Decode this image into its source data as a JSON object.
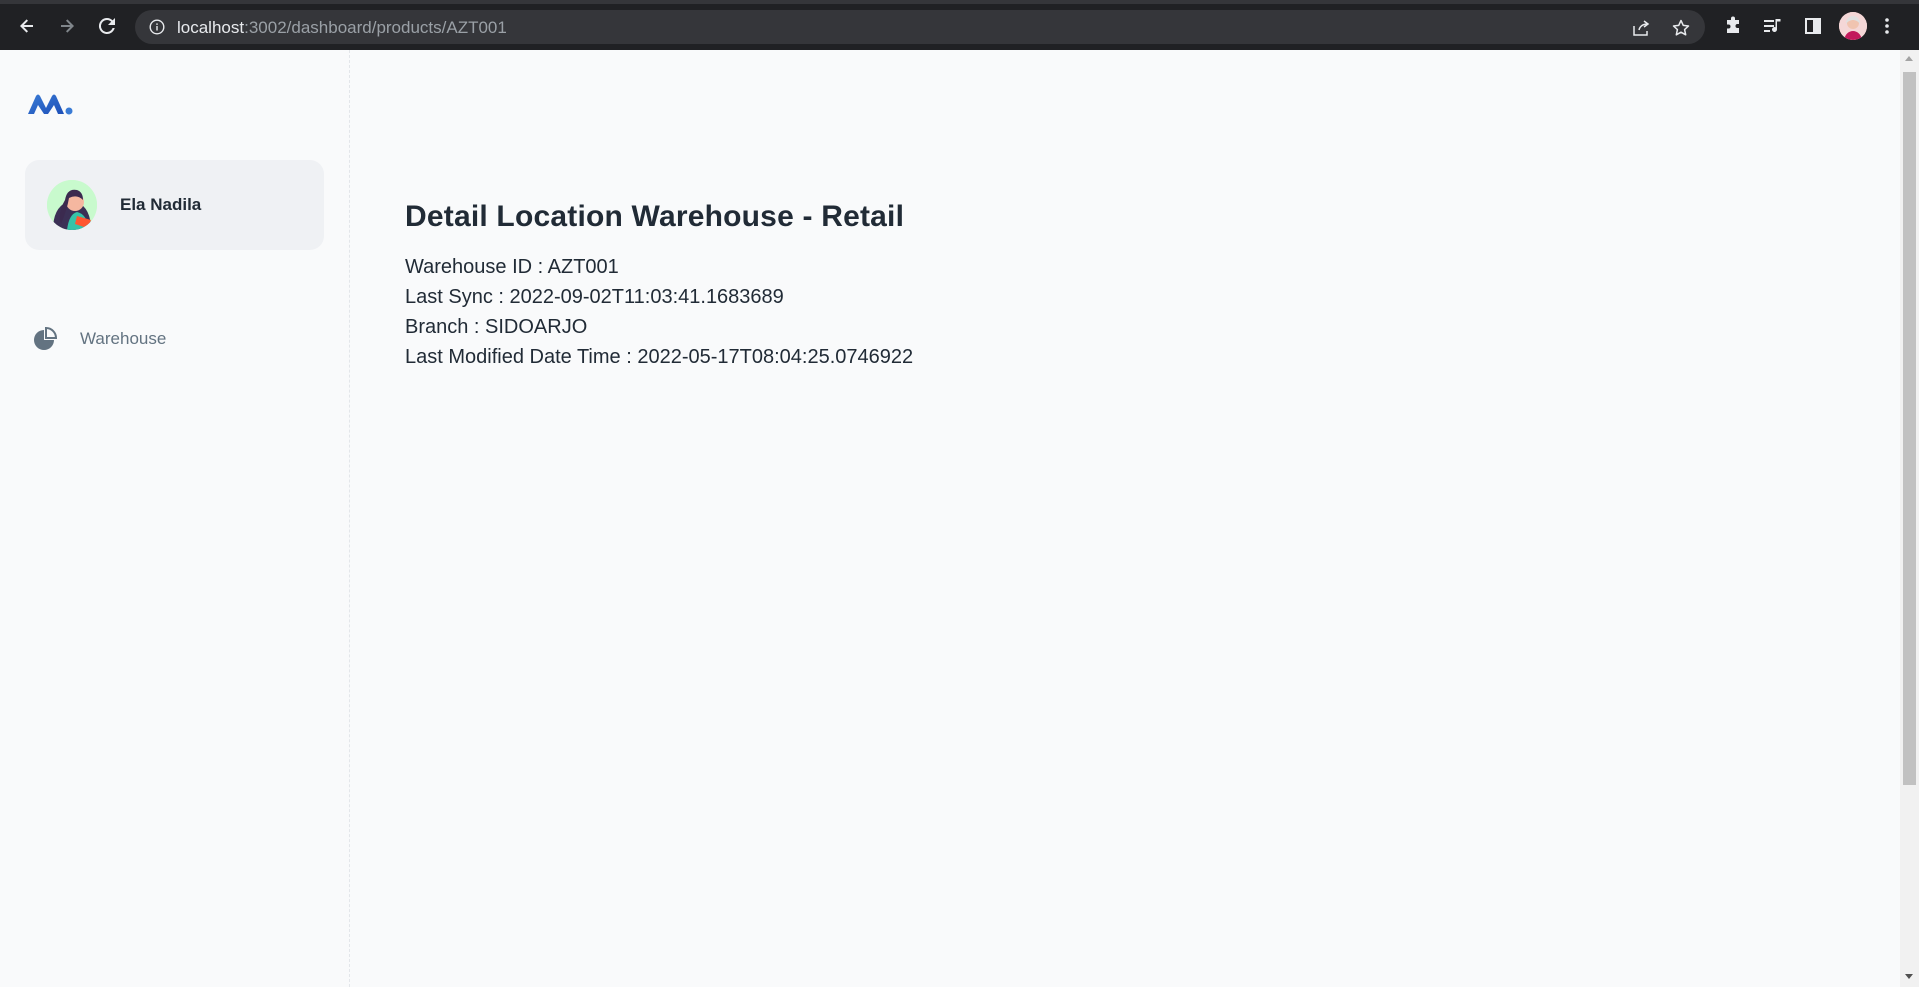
{
  "browser": {
    "url_host": "localhost",
    "url_rest": ":3002/dashboard/products/AZT001"
  },
  "sidebar": {
    "account_name": "Ela Nadila",
    "nav_items": [
      {
        "label": "Warehouse",
        "icon": "pie-chart-icon"
      }
    ]
  },
  "main": {
    "title": "Detail Location Warehouse - Retail",
    "details": [
      "Warehouse ID : AZT001",
      "Last Sync : 2022-09-02T11:03:41.1683689",
      "Branch : SIDOARJO",
      "Last Modified Date Time : 2022-05-17T08:04:25.0746922"
    ]
  },
  "colors": {
    "chrome_bg": "#202124",
    "omnibox_bg": "#35363a",
    "page_bg": "#f9fafb",
    "text_primary": "#212b36",
    "text_secondary": "#637381",
    "brand_blue": "#2065d1"
  }
}
